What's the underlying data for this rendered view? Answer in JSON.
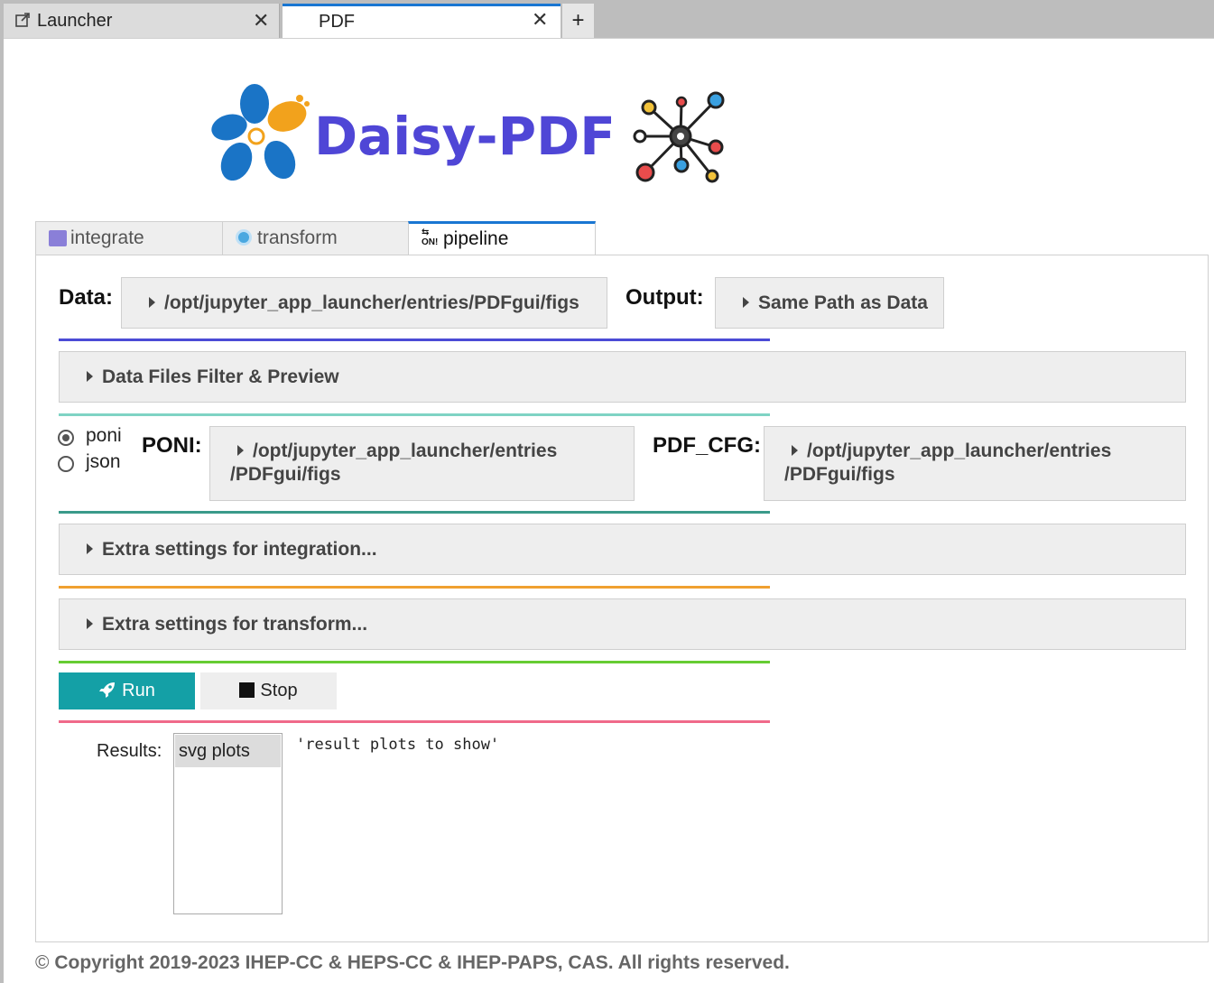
{
  "browser_tabs": [
    {
      "label": "Launcher",
      "icon": "external-link-icon"
    },
    {
      "label": "PDF"
    }
  ],
  "new_tab_label": "+",
  "logo": {
    "text": "Daisy-PDF"
  },
  "widget_tabs": [
    {
      "label": "integrate",
      "icon": "menorah-icon"
    },
    {
      "label": "transform",
      "icon": "swirl-icon"
    },
    {
      "label": "pipeline",
      "icon": "on-arrow-icon",
      "active": true
    }
  ],
  "data_label": "Data:",
  "data_path": "/opt/jupyter_app_launcher/entries/PDFgui/figs",
  "output_label": "Output:",
  "output_value": "Same Path as Data",
  "filter_accordion": "Data Files Filter & Preview",
  "radio_options": [
    "poni",
    "json"
  ],
  "radio_selected": "poni",
  "poni_label": "PONI:",
  "poni_path_line1": "/opt/jupyter_app_launcher/entries",
  "poni_path_line2": "/PDFgui/figs",
  "pdfcfg_label": "PDF_CFG:",
  "pdfcfg_path_line1": "/opt/jupyter_app_launcher/entries",
  "pdfcfg_path_line2": "/PDFgui/figs",
  "integration_accordion": "Extra settings for integration...",
  "transform_accordion": "Extra settings for transform...",
  "run_label": "Run",
  "stop_label": "Stop",
  "results_label": "Results:",
  "results_options": [
    "svg plots"
  ],
  "result_placeholder": "'result plots to show'",
  "copyright": "Copyright 2019-2023 IHEP-CC & HEPS-CC & IHEP-PAPS, CAS. All rights reserved.",
  "colors": {
    "accent_blue": "#4f46d6",
    "run_button": "#14a0a6",
    "divider_1": "#4b4bd6",
    "divider_2": "#7fd3c4",
    "divider_3": "#3a9a8a",
    "divider_4": "#f0a030",
    "divider_5": "#66cc33",
    "divider_6": "#f06a8a"
  }
}
